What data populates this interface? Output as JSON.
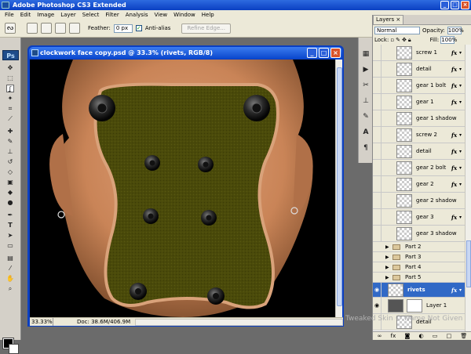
{
  "app": {
    "title": "Adobe Photoshop CS3 Extended",
    "window_buttons": [
      "_",
      "□",
      "×"
    ]
  },
  "menubar": {
    "items": [
      "File",
      "Edit",
      "Image",
      "Layer",
      "Select",
      "Filter",
      "Analysis",
      "View",
      "Window",
      "Help"
    ]
  },
  "options": {
    "feather_label": "Feather:",
    "feather_value": "0 px",
    "antialias_label": "Anti-alias",
    "antialias_checked": true,
    "refine_label": "Refine Edge..."
  },
  "toolbox": {
    "logo": "Ps"
  },
  "document": {
    "title": "clockwork face copy.psd @ 33.3% (rivets, RGB/8)",
    "zoom": "33.33%",
    "doc_size": "Doc: 38.6M/406.9M",
    "plate_color": "#4a4a0a",
    "plate_border": "#d9a27a"
  },
  "layers_panel": {
    "tab_label": "Layers",
    "blend_mode": "Normal",
    "opacity_label": "Opacity:",
    "opacity_value": "100%",
    "lock_label": "Lock:",
    "fill_label": "Fill:",
    "fill_value": "100%",
    "layers": [
      {
        "name": "screw 1",
        "fx": true
      },
      {
        "name": "detail",
        "fx": true
      },
      {
        "name": "gear 1 bolt",
        "fx": true
      },
      {
        "name": "gear 1",
        "fx": true
      },
      {
        "name": "gear 1 shadow",
        "fx": false
      },
      {
        "name": "screw 2",
        "fx": true
      },
      {
        "name": "detail",
        "fx": true
      },
      {
        "name": "gear 2 bolt",
        "fx": true
      },
      {
        "name": "gear 2",
        "fx": true
      },
      {
        "name": "gear 2 shadow",
        "fx": false
      },
      {
        "name": "gear 3",
        "fx": true
      },
      {
        "name": "gear 3 shadow",
        "fx": false
      }
    ],
    "groups": [
      "Part 2",
      "Part 3",
      "Part 4",
      "Part 5"
    ],
    "selected_layer": "rivets",
    "bottom_layer": "Layer 1",
    "bottom_layer_2": "detail",
    "selection_color": "#3169c6"
  },
  "watermark": "Tweaked Skin © Name Not Given"
}
